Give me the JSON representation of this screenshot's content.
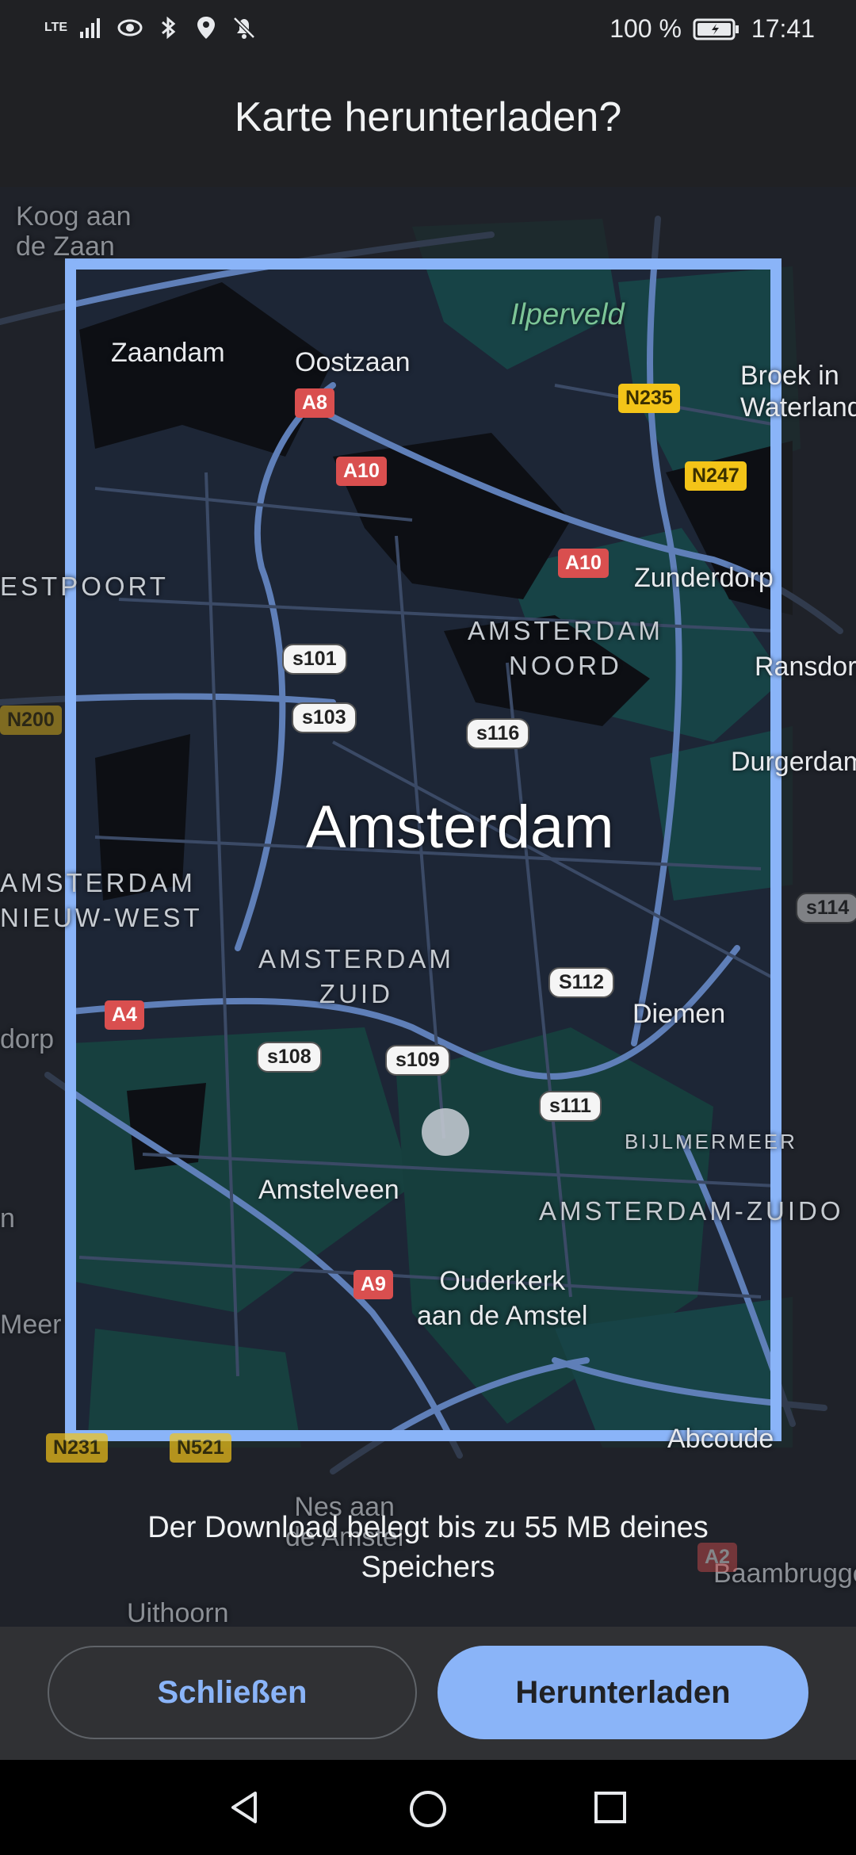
{
  "status": {
    "network": "LTE",
    "battery": "100 %",
    "time": "17:41",
    "icons": [
      "signal-icon",
      "eye-icon",
      "bluetooth-icon",
      "location-icon",
      "bell-off-icon",
      "battery-icon"
    ]
  },
  "dialog": {
    "title": "Karte herunterladen?",
    "size_note": "Der Download belegt bis zu 55 MB deines Speichers",
    "close_label": "Schließen",
    "download_label": "Herunterladen"
  },
  "map": {
    "places": {
      "koog": "Koog aan\nde Zaan",
      "zaandam": "Zaandam",
      "oostzaan": "Oostzaan",
      "ilperveld": "Ilperveld",
      "broek": "Broek in\nWaterland",
      "westpoort": "ESTPOORT",
      "zunderdorp": "Zunderdorp",
      "noord": "AMSTERDAM\nNOORD",
      "ransdorp": "Ransdorp",
      "durgerdam": "Durgerdam",
      "amsterdam": "Amsterdam",
      "nieuwwest": "AMSTERDAM\nNIEUW-WEST",
      "zuid": "AMSTERDAM\nZUID",
      "diemen": "Diemen",
      "dorp": "dorp",
      "bijlmermeer": "BIJLMERMEER",
      "amstelveen": "Amstelveen",
      "zuidoost": "AMSTERDAM-ZUIDO",
      "ouderkerk": "Ouderkerk\naan de Amstel",
      "meer": "Meer",
      "abcoude": "Abcoude",
      "nesaan": "Nes aan\nde Amstel",
      "uithoorn": "Uithoorn",
      "baambrugge": "Baambrugge",
      "n": "n"
    },
    "shields": {
      "a8": "A8",
      "a10a": "A10",
      "a10b": "A10",
      "n235": "N235",
      "n247": "N247",
      "s101": "s101",
      "s103": "s103",
      "s116": "s116",
      "n200": "N200",
      "s114": "s114",
      "a4": "A4",
      "s112": "S112",
      "s108": "s108",
      "s109": "s109",
      "s111": "s111",
      "a9": "A9",
      "n231a": "N231",
      "n231b": "N521",
      "a2": "A2"
    }
  }
}
